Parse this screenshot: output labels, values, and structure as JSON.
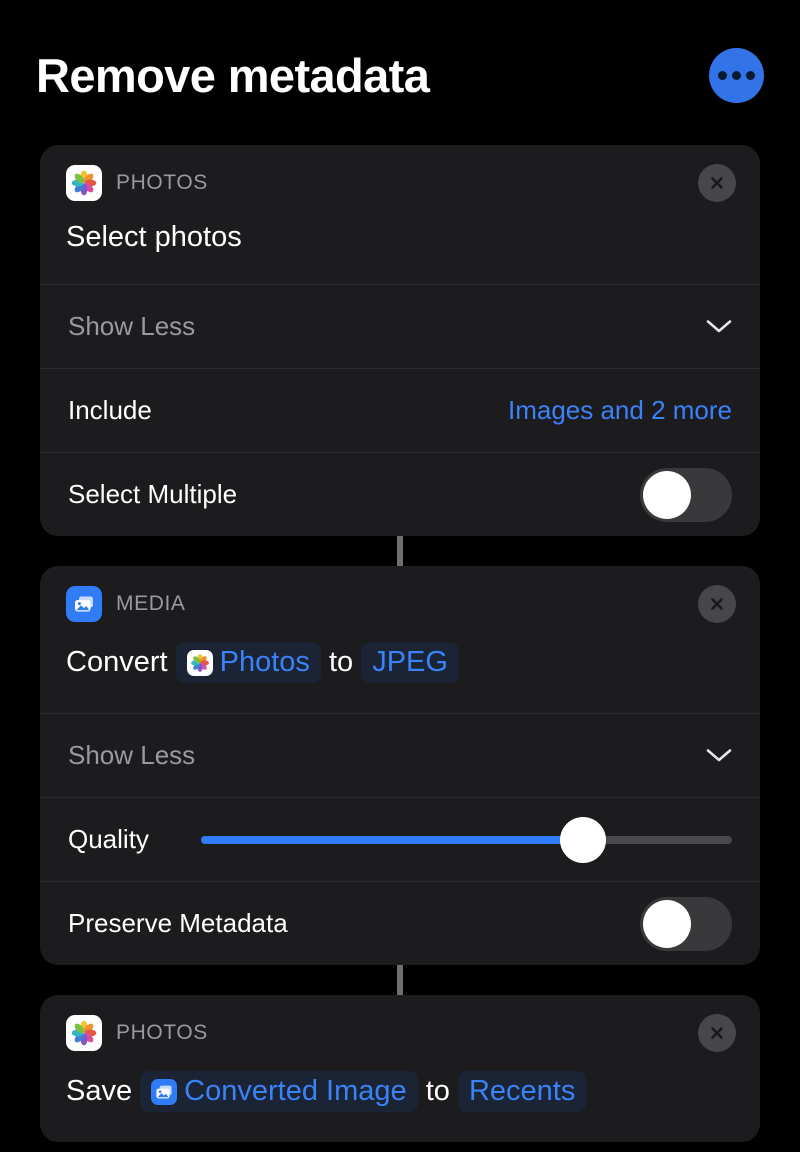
{
  "header": {
    "title": "Remove metadata",
    "menu_button_label": "More options",
    "accent_color": "#3273e8"
  },
  "theme": {
    "background": "#000000",
    "card_background": "#1c1c1e",
    "blue": "#3a82f7",
    "muted_text": "#9a9a9e",
    "toggle_off_track": "#39393c"
  },
  "actions": [
    {
      "app_label": "PHOTOS",
      "app_icon": "photos-app-icon",
      "close_label": "Remove action",
      "title": "Select photos",
      "disclosure": {
        "label": "Show Less",
        "icon": "chevron-down-icon"
      },
      "parameters": [
        {
          "type": "value",
          "label": "Include",
          "value": "Images and 2 more"
        },
        {
          "type": "toggle",
          "label": "Select Multiple",
          "value": "off"
        }
      ]
    },
    {
      "app_label": "MEDIA",
      "app_icon": "media-app-icon",
      "close_label": "Remove action",
      "segments": [
        {
          "kind": "text",
          "text": "Convert "
        },
        {
          "kind": "token",
          "text": "Photos",
          "icon": "photos-app-icon"
        },
        {
          "kind": "text",
          "text": " to "
        },
        {
          "kind": "token",
          "text": "JPEG",
          "icon": "none"
        }
      ],
      "disclosure": {
        "label": "Show Less",
        "icon": "chevron-down-icon"
      },
      "parameters": [
        {
          "type": "slider",
          "label": "Quality",
          "value": 72,
          "min": 0,
          "max": 100
        },
        {
          "type": "toggle",
          "label": "Preserve Metadata",
          "value": "off"
        }
      ]
    },
    {
      "app_label": "PHOTOS",
      "app_icon": "photos-app-icon",
      "close_label": "Remove action",
      "segments": [
        {
          "kind": "text",
          "text": "Save "
        },
        {
          "kind": "token",
          "text": "Converted Image",
          "icon": "media-app-icon"
        },
        {
          "kind": "text",
          "text": " to "
        },
        {
          "kind": "token",
          "text": "Recents",
          "icon": "none"
        }
      ]
    }
  ]
}
